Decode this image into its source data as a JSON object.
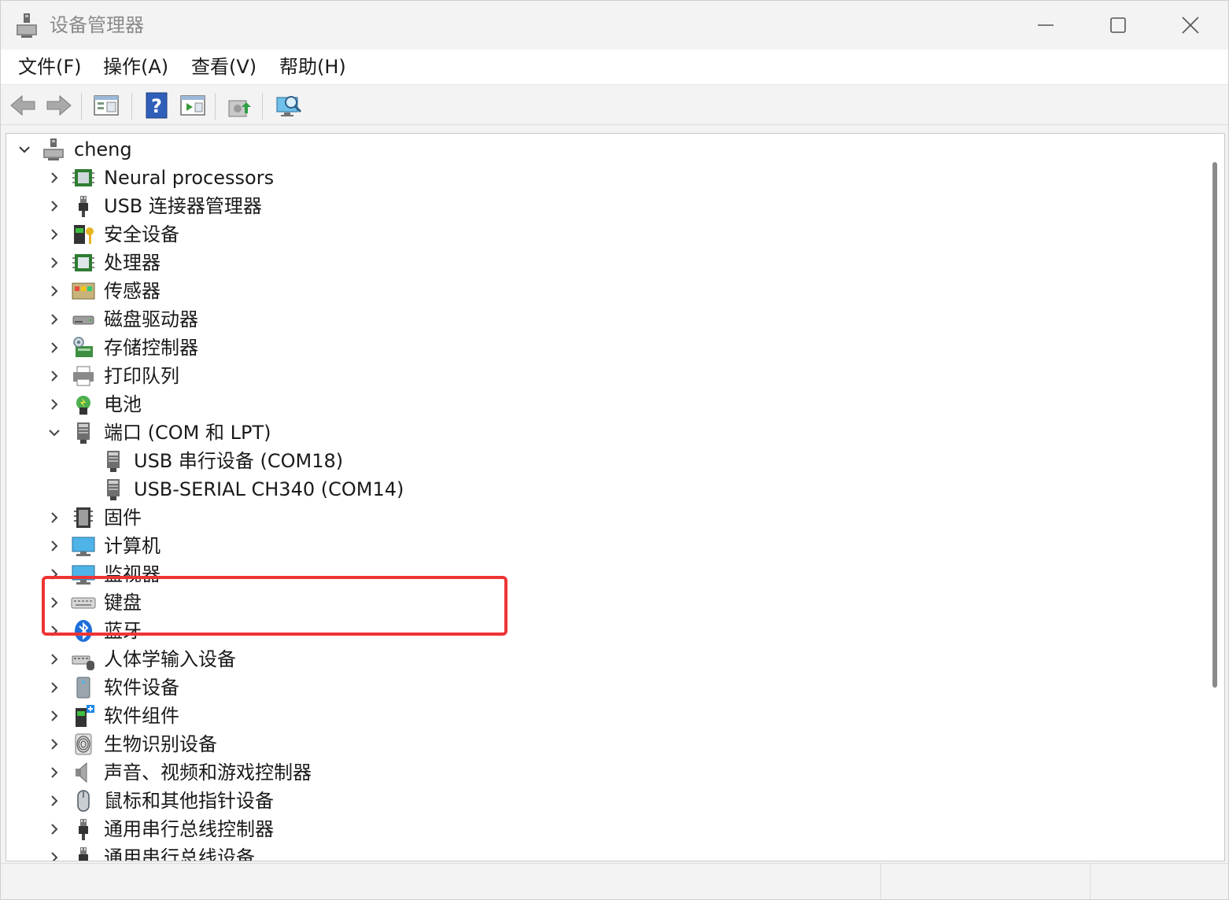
{
  "window": {
    "title": "设备管理器"
  },
  "menu": [
    {
      "label": "文件(F)"
    },
    {
      "label": "操作(A)"
    },
    {
      "label": "查看(V)"
    },
    {
      "label": "帮助(H)"
    }
  ],
  "toolbar": {
    "buttons": [
      "back-icon",
      "forward-icon",
      "properties-view-icon",
      "help-icon",
      "action-view-icon",
      "update-driver-icon",
      "scan-hardware-icon"
    ]
  },
  "tree": {
    "root": "cheng",
    "nodes": [
      {
        "label": "Neural processors",
        "icon": "chip-icon",
        "expanded": false
      },
      {
        "label": "USB 连接器管理器",
        "icon": "usb-plug-icon",
        "expanded": false
      },
      {
        "label": "安全设备",
        "icon": "security-key-icon",
        "expanded": false
      },
      {
        "label": "处理器",
        "icon": "processor-icon",
        "expanded": false
      },
      {
        "label": "传感器",
        "icon": "sensor-icon",
        "expanded": false
      },
      {
        "label": "磁盘驱动器",
        "icon": "disk-drive-icon",
        "expanded": false
      },
      {
        "label": "存储控制器",
        "icon": "storage-controller-icon",
        "expanded": false
      },
      {
        "label": "打印队列",
        "icon": "printer-icon",
        "expanded": false
      },
      {
        "label": "电池",
        "icon": "battery-icon",
        "expanded": false
      },
      {
        "label": "端口 (COM 和 LPT)",
        "icon": "port-icon",
        "expanded": true,
        "children": [
          {
            "label": "USB 串行设备 (COM18)",
            "icon": "port-icon"
          },
          {
            "label": "USB-SERIAL CH340 (COM14)",
            "icon": "port-icon"
          }
        ]
      },
      {
        "label": "固件",
        "icon": "firmware-icon",
        "expanded": false
      },
      {
        "label": "计算机",
        "icon": "computer-icon",
        "expanded": false
      },
      {
        "label": "监视器",
        "icon": "monitor-icon",
        "expanded": false
      },
      {
        "label": "键盘",
        "icon": "keyboard-icon",
        "expanded": false
      },
      {
        "label": "蓝牙",
        "icon": "bluetooth-icon",
        "expanded": false
      },
      {
        "label": "人体学输入设备",
        "icon": "hid-icon",
        "expanded": false
      },
      {
        "label": "软件设备",
        "icon": "software-device-icon",
        "expanded": false
      },
      {
        "label": "软件组件",
        "icon": "software-component-icon",
        "expanded": false
      },
      {
        "label": "生物识别设备",
        "icon": "fingerprint-icon",
        "expanded": false
      },
      {
        "label": "声音、视频和游戏控制器",
        "icon": "speaker-icon",
        "expanded": false
      },
      {
        "label": "鼠标和其他指针设备",
        "icon": "mouse-icon",
        "expanded": false
      },
      {
        "label": "通用串行总线控制器",
        "icon": "usb-plug-icon",
        "expanded": false
      },
      {
        "label": "通用串行总线设备",
        "icon": "usb-plug-icon",
        "expanded": false
      }
    ]
  },
  "highlight": {
    "color": "#ee3434"
  }
}
